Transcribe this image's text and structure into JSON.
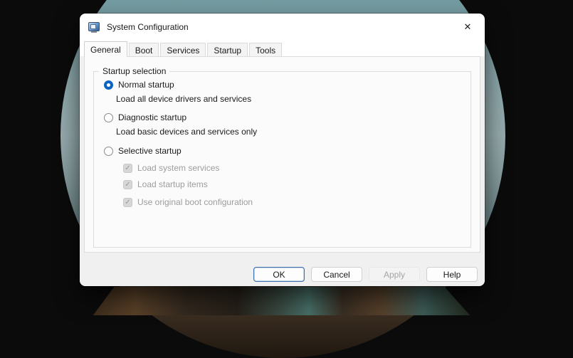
{
  "window": {
    "title": "System Configuration"
  },
  "glyphs": {
    "close": "✕",
    "check": "✓"
  },
  "tabs": [
    {
      "label": "General",
      "active": true
    },
    {
      "label": "Boot",
      "active": false
    },
    {
      "label": "Services",
      "active": false
    },
    {
      "label": "Startup",
      "active": false
    },
    {
      "label": "Tools",
      "active": false
    }
  ],
  "general": {
    "group_title": "Startup selection",
    "normal": {
      "label": "Normal startup",
      "description": "Load all device drivers and services",
      "selected": true
    },
    "diagnostic": {
      "label": "Diagnostic startup",
      "description": "Load basic devices and services only",
      "selected": false
    },
    "selective": {
      "label": "Selective startup",
      "selected": false,
      "items": [
        {
          "label": "Load system services",
          "checked": true,
          "disabled": true
        },
        {
          "label": "Load startup items",
          "checked": true,
          "disabled": true
        },
        {
          "label": "Use original boot configuration",
          "checked": true,
          "disabled": true
        }
      ]
    }
  },
  "buttons": {
    "ok": "OK",
    "cancel": "Cancel",
    "apply": "Apply",
    "help": "Help"
  },
  "colors": {
    "accent": "#0b64c4",
    "dialog_bg": "#f0f0f0",
    "pane_bg": "#fbfbfb",
    "disabled_text": "#9d9d9d",
    "wallpaper_teal": "#8fa9ac",
    "desktop_black": "#0b0b0b"
  }
}
